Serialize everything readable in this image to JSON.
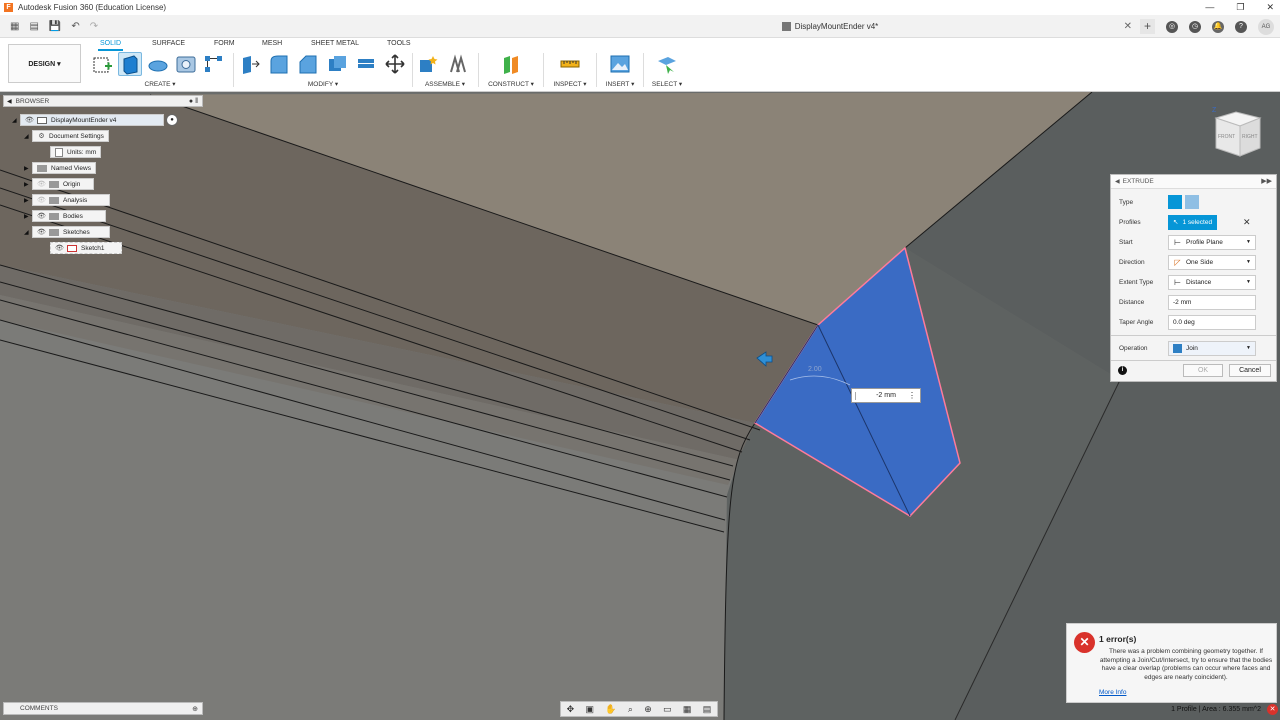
{
  "window": {
    "title": "Autodesk Fusion 360 (Education License)",
    "app_icon": "F",
    "controls": [
      "—",
      "❐",
      "✕"
    ]
  },
  "tabbar": {
    "doc_title": "DisplayMountEnder v4*",
    "close": "✕",
    "new_tab": "+",
    "avatar": "AG"
  },
  "ribbon": {
    "workspace": "DESIGN ▾",
    "tabs": [
      "SOLID",
      "SURFACE",
      "FORM",
      "MESH",
      "SHEET METAL",
      "TOOLS"
    ],
    "groups": {
      "create": "CREATE ▾",
      "modify": "MODIFY ▾",
      "assemble": "ASSEMBLE ▾",
      "construct": "CONSTRUCT ▾",
      "inspect": "INSPECT ▾",
      "insert": "INSERT ▾",
      "select": "SELECT ▾"
    }
  },
  "browser": {
    "header": "BROWSER",
    "header_btns": "● ‖",
    "root": "DisplayMountEnder v4",
    "items": {
      "doc_settings": "Document Settings",
      "units": "Units: mm",
      "named_views": "Named Views",
      "origin": "Origin",
      "analysis": "Analysis",
      "bodies": "Bodies",
      "sketches": "Sketches",
      "sketch1": "Sketch1"
    }
  },
  "extrude": {
    "title": "EXTRUDE",
    "rows": {
      "type": "Type",
      "profiles": "Profiles",
      "profiles_value": "1 selected",
      "start": "Start",
      "start_value": "Profile Plane",
      "direction": "Direction",
      "direction_value": "One Side",
      "extent": "Extent Type",
      "extent_value": "Distance",
      "distance": "Distance",
      "distance_value": "-2 mm",
      "taper": "Taper Angle",
      "taper_value": "0.0 deg",
      "operation": "Operation",
      "operation_value": "Join"
    },
    "ok": "OK",
    "cancel": "Cancel"
  },
  "canvas": {
    "distance_input": "-2 mm",
    "dim_label": "2.00"
  },
  "viewcube": {
    "front": "FRONT",
    "right": "RIGHT",
    "axis_z": "Z"
  },
  "error": {
    "title": "1 error(s)",
    "message": "There was a problem combining geometry together. If attempting a Join/Cut/Intersect, try to ensure that the bodies have a clear overlap (problems can occur where faces and edges are nearly coincident).",
    "link": "More Info"
  },
  "comments": {
    "label": "COMMENTS"
  },
  "status": {
    "text": "1 Profile | Area : 6.355 mm^2"
  },
  "colors": {
    "accent": "#0696d7",
    "profile_fill": "#3a6bc4",
    "error": "#d9322b"
  }
}
